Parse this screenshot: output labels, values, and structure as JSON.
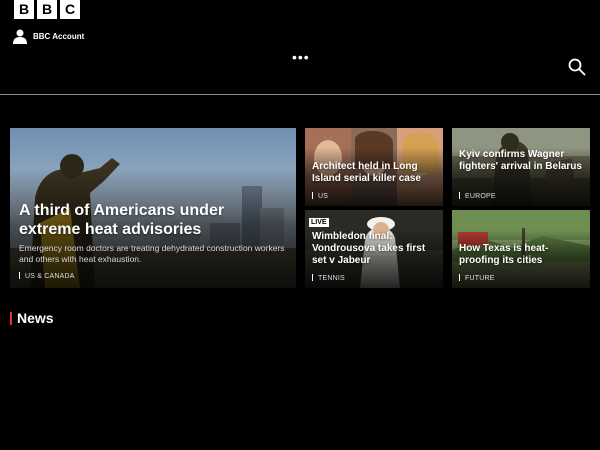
{
  "header": {
    "logo_letters": [
      "B",
      "B",
      "C"
    ],
    "account_label": "BBC Account",
    "more_label": "•••",
    "icons": [
      "user-icon",
      "more-icon",
      "search-icon"
    ]
  },
  "cards": {
    "main": {
      "headline": "A third of Americans under extreme heat advisories",
      "summary": "Emergency room doctors are treating dehydrated construction workers and others with heat exhaustion.",
      "tag": "US & CANADA"
    },
    "c2": {
      "headline": "Architect held in Long Island serial killer case",
      "tag": "US"
    },
    "c3": {
      "headline": "Kyiv confirms Wagner fighters' arrival in Belarus",
      "tag": "EUROPE"
    },
    "c4": {
      "badge": "LIVE",
      "headline": "Wimbledon final: Vondrousova takes first set v Jabeur",
      "tag": "TENNIS"
    },
    "c5": {
      "headline": "How Texas is heat-proofing its cities",
      "tag": "FUTURE"
    }
  },
  "section": {
    "title": "News",
    "accent": "#e2352c"
  }
}
